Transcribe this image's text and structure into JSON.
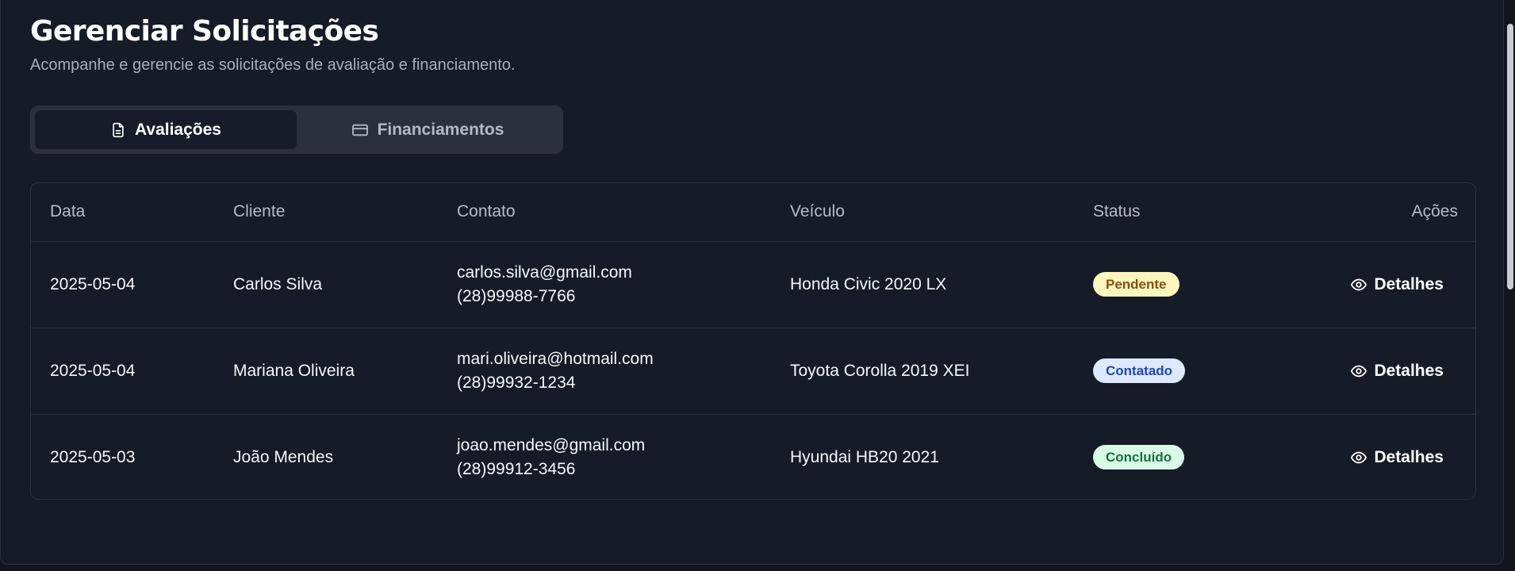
{
  "page": {
    "title": "Gerenciar Solicitações",
    "subtitle": "Acompanhe e gerencie as solicitações de avaliação e financiamento."
  },
  "tabs": [
    {
      "label": "Avaliações",
      "icon": "document-icon",
      "active": true
    },
    {
      "label": "Financiamentos",
      "icon": "credit-card-icon",
      "active": false
    }
  ],
  "table": {
    "headers": [
      "Data",
      "Cliente",
      "Contato",
      "Veículo",
      "Status",
      "Ações"
    ],
    "rows": [
      {
        "date": "2025-05-04",
        "client": "Carlos Silva",
        "email": "carlos.silva@gmail.com",
        "phone": "(28)99988-7766",
        "vehicle": "Honda Civic 2020 LX",
        "status": "Pendente",
        "status_color": "#fef6bf",
        "action": "Detalhes"
      },
      {
        "date": "2025-05-04",
        "client": "Mariana Oliveira",
        "email": "mari.oliveira@hotmail.com",
        "phone": "(28)99932-1234",
        "vehicle": "Toyota Corolla 2019 XEI",
        "status": "Contatado",
        "status_color": "#dce9ff",
        "action": "Detalhes"
      },
      {
        "date": "2025-05-03",
        "client": "João Mendes",
        "email": "joao.mendes@gmail.com",
        "phone": "(28)99912-3456",
        "vehicle": "Hyundai HB20 2021",
        "status": "Concluído",
        "status_color": "#d8fbe5",
        "action": "Detalhes"
      }
    ]
  },
  "colors": {
    "background": "#111520",
    "card": "#161b28",
    "border": "#293140",
    "text": "#f6f7f9"
  }
}
